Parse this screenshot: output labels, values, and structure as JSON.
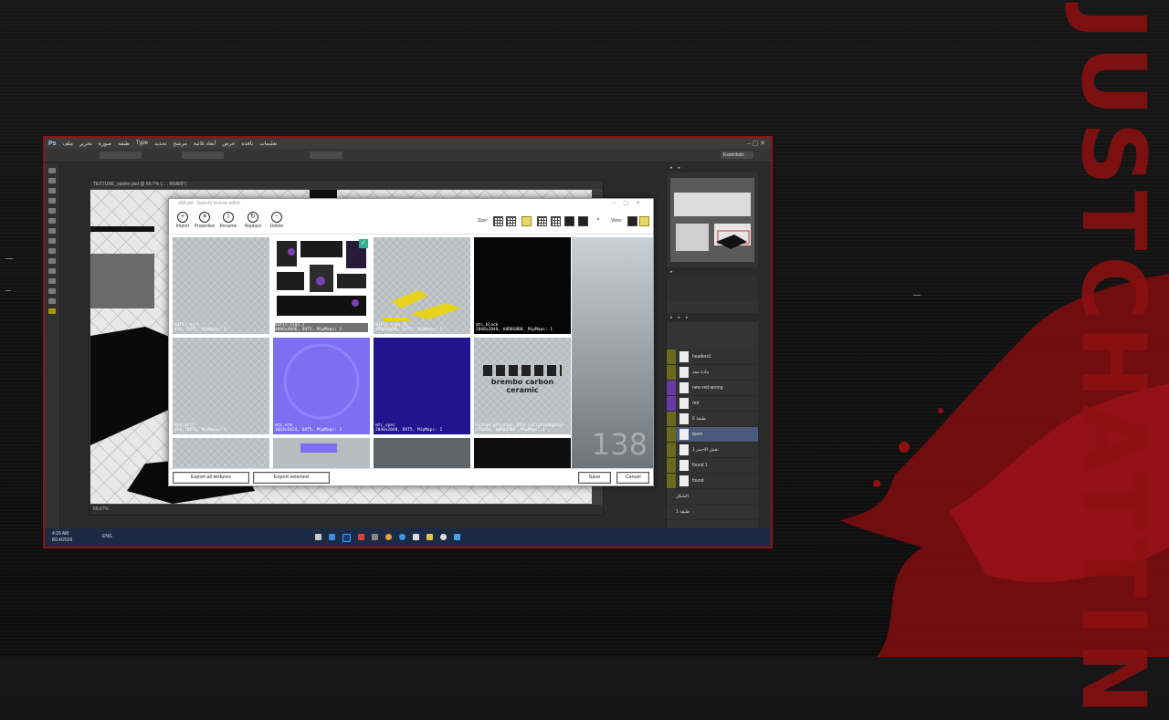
{
  "channel_title": "JUSTCHATTIN",
  "photoshop": {
    "menu": [
      "Ps",
      "ملف",
      "تحرير",
      "صورة",
      "طبقة",
      "Type",
      "تحديد",
      "مرشح",
      "أبعاد ثلاثية",
      "عرض",
      "نافذة",
      "تعليمات"
    ],
    "essentials": "Essentials",
    "document_title": "TEXTURE_spoiler.psd @ 66.7% (... , RGB/8*)",
    "zoom": "66.67%",
    "layers": [
      {
        "name": "headers1"
      },
      {
        "name": "مادة معد"
      },
      {
        "name": "new-red-wrong"
      },
      {
        "name": "red"
      },
      {
        "name": "طبقة 6"
      },
      {
        "name": "tpars"
      },
      {
        "name": "نقش الاحمر 1"
      },
      {
        "name": "found 1"
      },
      {
        "name": "found"
      },
      {
        "name": "الشكل"
      },
      {
        "name": "طبقة 1"
      }
    ]
  },
  "taskbar": {
    "time": "4:26 AM",
    "date": "8/14/2026",
    "lang": "ENG"
  },
  "dialog": {
    "title": "sfdf.ytd - OpenIV texture editor",
    "toolbar": {
      "import": "Import",
      "properties": "Properties",
      "rename": "Rename",
      "replace": "Replace",
      "delete": "Delete",
      "size_label": "Size:",
      "view_label": "View:"
    },
    "textures": [
      {
        "name": "m3f15_dirt",
        "info": "4x4, DXT5, MipMaps: 1",
        "kind": "checker"
      },
      {
        "name": "m3f15_sign_1",
        "info": "4096x4096, DXT5, MipMaps: 1",
        "kind": "livery",
        "selected": true
      },
      {
        "name": "m3f15_sign_11",
        "info": "4096x4096, DXT5, MipMaps: 1",
        "kind": "yellow"
      },
      {
        "name": "mtc_black",
        "info": "2048x2048, A8R8G8B8, MipMaps: 1",
        "kind": "black"
      },
      {
        "name": "mtc_dirt",
        "info": "4x4, DXT5, MipMaps: 1",
        "kind": "checker"
      },
      {
        "name": "mtc_nrm",
        "info": "1024x1024, DXT5, MipMaps: 1",
        "kind": "normal"
      },
      {
        "name": "mtc_spec",
        "info": "2048x2048, DXT5, MipMaps: 1",
        "kind": "spec"
      },
      {
        "name": "nissan_gtrnismo_2024_callperbadging",
        "info": "256x64, A8R8G8B8, MipMaps: 1",
        "kind": "brembo",
        "overlay": "brembo carbon ceramic"
      }
    ],
    "texture_count": "138",
    "buttons": {
      "export_all": "Export all textures",
      "export_selected": "Export selected",
      "save": "Save",
      "cancel": "Cancel"
    }
  },
  "colors": {
    "accent_red": "#8e1216",
    "dialog_bg": "#ffffff",
    "selected_check": "#2fb08f"
  }
}
